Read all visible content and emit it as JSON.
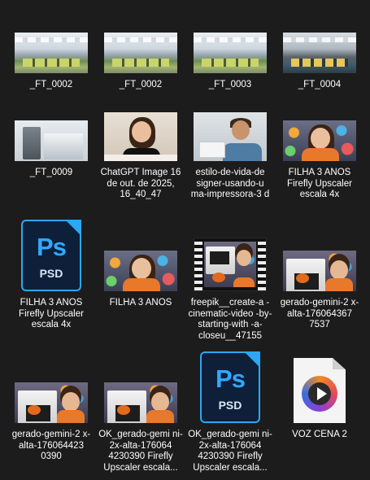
{
  "files": [
    {
      "name": "_FT_0002"
    },
    {
      "name": "_FT_0002"
    },
    {
      "name": "_FT_0003"
    },
    {
      "name": "_FT_0004"
    },
    {
      "name": "_FT_0009"
    },
    {
      "name": "ChatGPT Image 16 de out. de 2025, 16_40_47"
    },
    {
      "name": "estilo-de-vida-de signer-usando-u ma-impressora-3 d"
    },
    {
      "name": "FILHA 3 ANOS Firefly Upscaler escala 4x"
    },
    {
      "name": "FILHA 3 ANOS Firefly Upscaler escala 4x",
      "icon_text": "Ps",
      "icon_label": "PSD"
    },
    {
      "name": "FILHA 3 ANOS"
    },
    {
      "name": "freepik__create-a -cinematic-video -by-starting-with -a-closeu__47155"
    },
    {
      "name": "gerado-gemini-2 x-alta-176064367 7537"
    },
    {
      "name": "gerado-gemini-2 x-alta-176064423 0390"
    },
    {
      "name": "OK_gerado-gemi ni-2x-alta-176064 4230390 Firefly Upscaler escala..."
    },
    {
      "name": "OK_gerado-gemi ni-2x-alta-176064 4230390 Firefly Upscaler escala...",
      "icon_text": "Ps",
      "icon_label": "PSD"
    },
    {
      "name": "VOZ CENA 2"
    }
  ]
}
